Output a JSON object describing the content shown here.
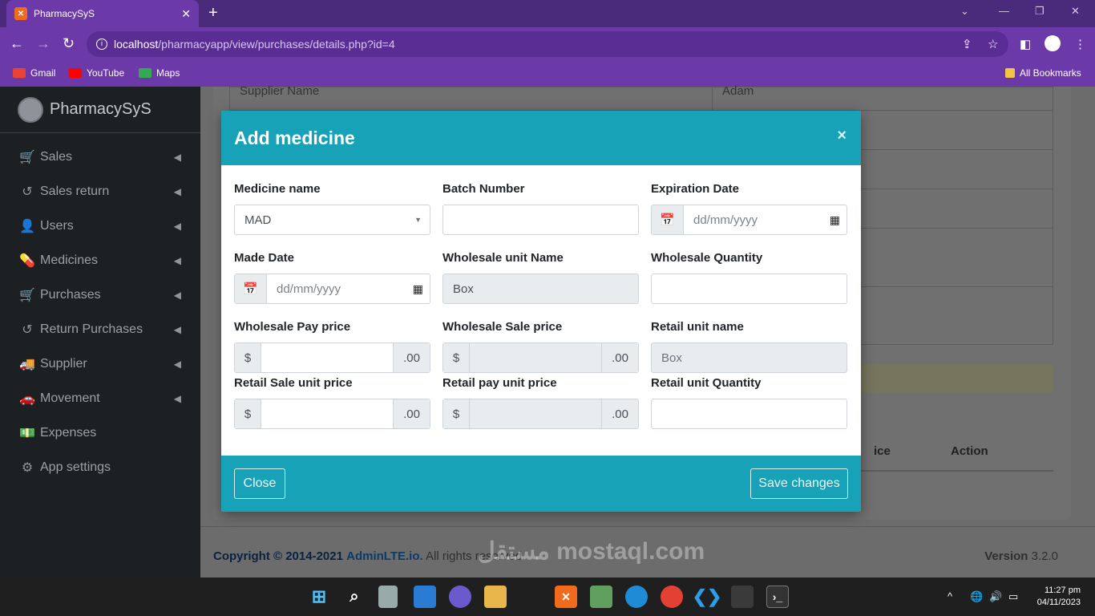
{
  "browser": {
    "tab_title": "PharmacySyS",
    "tab_close": "✕",
    "new_tab": "+",
    "url_host": "localhost",
    "url_path": "/pharmacyapp/view/purchases/details.php?id=4",
    "bookmarks": [
      "Gmail",
      "YouTube",
      "Maps"
    ],
    "all_bookmarks": "All Bookmarks"
  },
  "app": {
    "brand": "PharmacySyS",
    "sidebar": [
      {
        "label": "Sales",
        "icon": "cart-icon",
        "glyph": "🛒",
        "chevron": true
      },
      {
        "label": "Sales return",
        "icon": "undo-icon",
        "glyph": "↺",
        "chevron": true
      },
      {
        "label": "Users",
        "icon": "user-icon",
        "glyph": "👤",
        "chevron": true
      },
      {
        "label": "Medicines",
        "icon": "pills-icon",
        "glyph": "💊",
        "chevron": true
      },
      {
        "label": "Purchases",
        "icon": "cart-icon",
        "glyph": "🛒",
        "chevron": true
      },
      {
        "label": "Return Purchases",
        "icon": "undo-icon",
        "glyph": "↺",
        "chevron": true
      },
      {
        "label": "Supplier",
        "icon": "truck-icon",
        "glyph": "🚚",
        "chevron": true
      },
      {
        "label": "Movement",
        "icon": "car-icon",
        "glyph": "🚗",
        "chevron": true
      },
      {
        "label": "Expenses",
        "icon": "money-icon",
        "glyph": "💵",
        "chevron": false
      },
      {
        "label": "App settings",
        "icon": "gear-icon",
        "glyph": "⚙",
        "chevron": false
      }
    ],
    "background": {
      "supplier_label": "Supplier Name",
      "supplier_value": "Adam",
      "col_price_partial": "ice",
      "col_action": "Action"
    },
    "footer": {
      "copyright": "Copyright © 2014-2021",
      "brand_link": "AdminLTE.io.",
      "rights": "All rights reserved.",
      "version_label": "Version",
      "version_value": "3.2.0"
    }
  },
  "modal": {
    "title": "Add medicine",
    "close_x": "×",
    "fields": {
      "medicine_name": {
        "label": "Medicine name",
        "value": "MAD"
      },
      "batch_number": {
        "label": "Batch Number",
        "value": ""
      },
      "expiration_date": {
        "label": "Expiration Date",
        "placeholder": "dd/mm/yyyy"
      },
      "made_date": {
        "label": "Made Date",
        "placeholder": "dd/mm/yyyy"
      },
      "wholesale_unit_name": {
        "label": "Wholesale unit Name",
        "value": "Box"
      },
      "wholesale_quantity": {
        "label": "Wholesale Quantity",
        "value": ""
      },
      "wholesale_pay_price": {
        "label": "Wholesale Pay price",
        "prefix": "$",
        "suffix": ".00"
      },
      "wholesale_sale_price": {
        "label": "Wholesale Sale price",
        "prefix": "$",
        "suffix": ".00"
      },
      "retail_unit_name": {
        "label": "Retail unit name",
        "value": "Box"
      },
      "retail_sale_unit_price": {
        "label": "Retail Sale unit price",
        "prefix": "$",
        "suffix": ".00"
      },
      "retail_pay_unit_price": {
        "label": "Retail pay unit price",
        "prefix": "$",
        "suffix": ".00"
      },
      "retail_unit_quantity": {
        "label": "Retail unit Quantity",
        "value": ""
      }
    },
    "close_button": "Close",
    "save_button": "Save changes"
  },
  "taskbar": {
    "time": "11:27 pm",
    "date": "04/11/2023"
  },
  "watermark": "مستقل mostaql.com",
  "colors": {
    "modal_header": "#17a2b8",
    "sidebar": "#1c2023",
    "browser": "#6b3aa8"
  }
}
